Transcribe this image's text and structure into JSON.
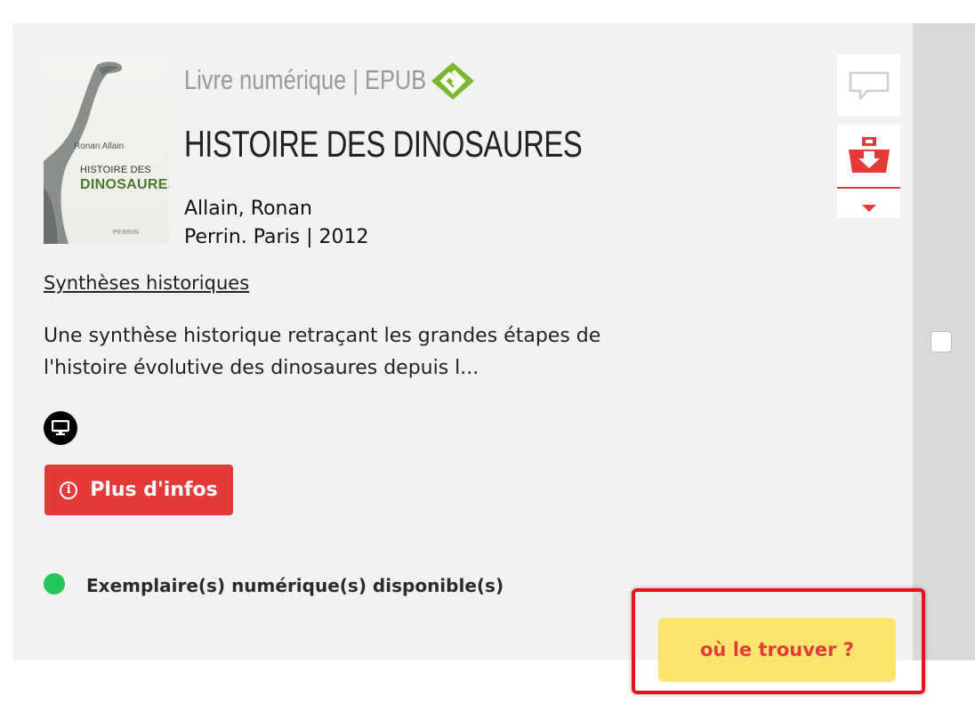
{
  "record": {
    "format_label": "Livre numérique | EPUB",
    "title": "HISTOIRE DES DINOSAURES",
    "author": "Allain, Ronan",
    "publisher_year": "Perrin. Paris | 2012",
    "series": "Synthèses historiques",
    "description_lines": [
      "Une synthèse historique retraçant les grandes étapes de",
      "l'histoire évolutive des dinosaures depuis l..."
    ],
    "cover": {
      "author": "Ronan Allain",
      "title_line1": "HISTOIRE DES",
      "title_line2": "DINOSAURES",
      "publisher": "PERRIN"
    }
  },
  "actions": {
    "more_info_label": "Plus d'infos",
    "info_glyph": "i",
    "where_label": "où le trouver ?"
  },
  "availability": {
    "text": "Exemplaire(s) numérique(s) disponible(s)",
    "status_color": "#25c65b"
  },
  "icons": {
    "format": "epub-icon",
    "media": "monitor-icon",
    "comment": "comment-icon",
    "basket": "basket-download-icon",
    "dropdown": "caret-down-icon"
  },
  "colors": {
    "accent_red": "#e43a38",
    "where_button_bg": "#fbe56c",
    "epub_green": "#7cb82f",
    "card_bg": "#f2f2f2"
  }
}
